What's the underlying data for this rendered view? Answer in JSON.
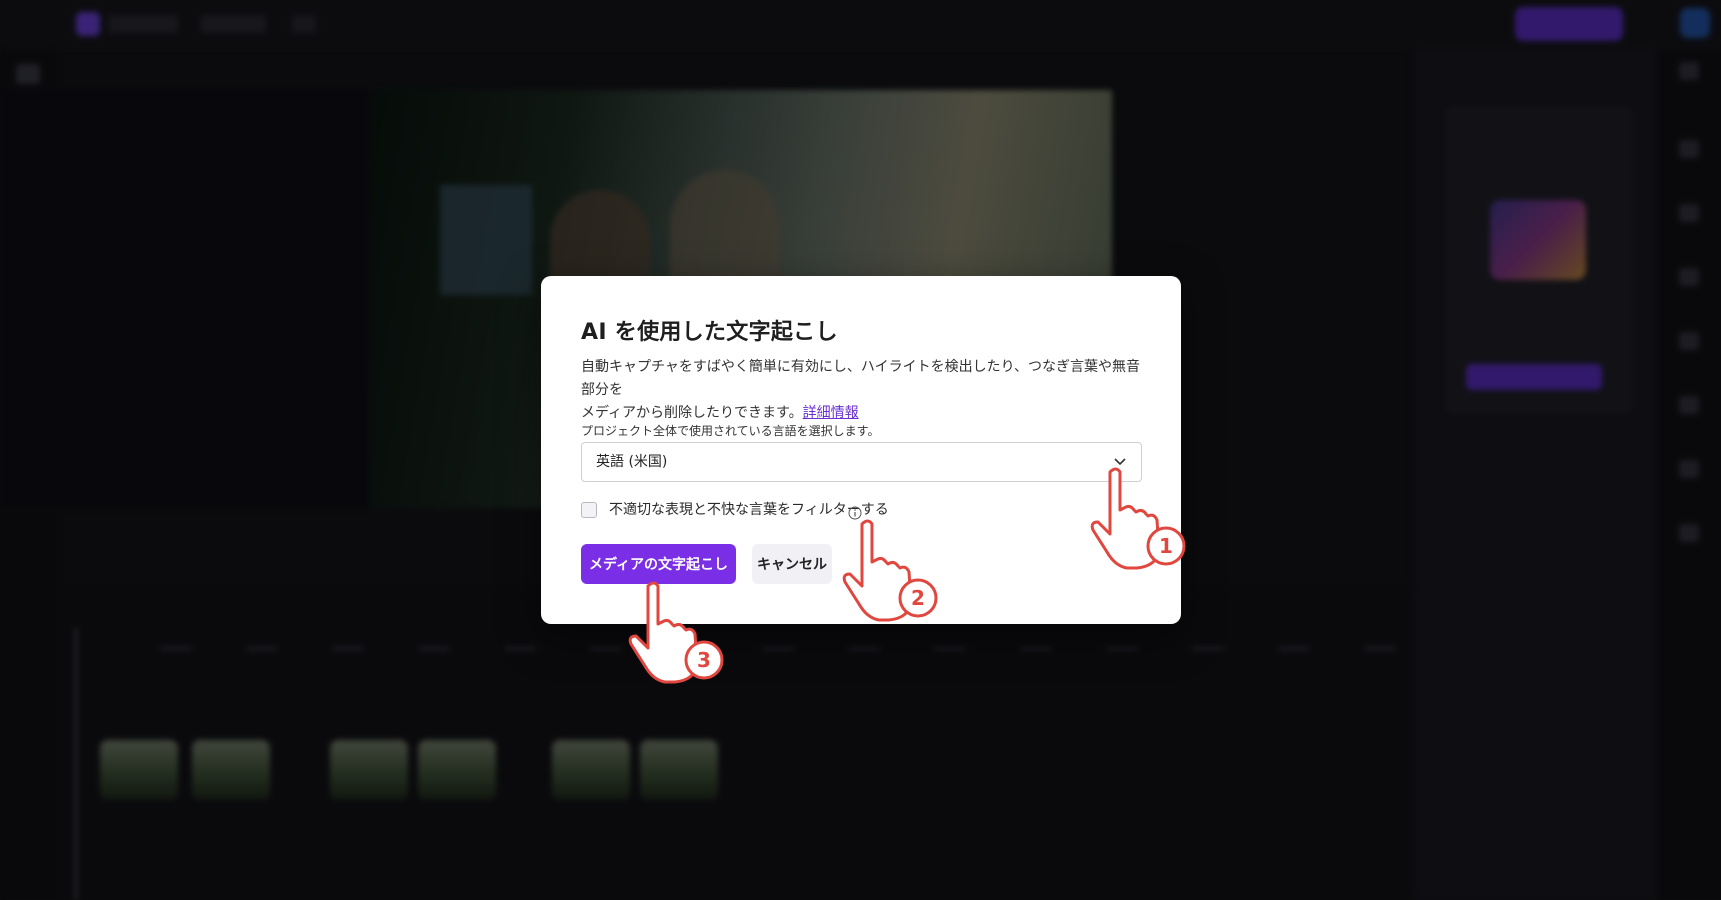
{
  "dialog": {
    "title": "AI を使用した文字起こし",
    "description_line1": "自動キャプチャをすばやく簡単に有効にし、ハイライトを検出したり、つなぎ言葉や無音部分を",
    "description_line2": "メディアから削除したりできます。",
    "learn_more_link": "詳細情報",
    "language_label": "プロジェクト全体で使用されている言語を選択します。",
    "language_selected": "英語 (米国)",
    "filter_checkbox_label": "不適切な表現と不快な言葉をフィルターする",
    "filter_checked": false,
    "primary_button": "メディアの文字起こし",
    "cancel_button": "キャンセル"
  },
  "callouts": [
    {
      "number": "1",
      "icon": "pointing-hand-icon"
    },
    {
      "number": "2",
      "icon": "pointing-hand-icon"
    },
    {
      "number": "3",
      "icon": "pointing-hand-icon"
    }
  ],
  "colors": {
    "primary": "#7a2fe6",
    "link": "#6a2fd6",
    "callout": "#e0473f"
  }
}
